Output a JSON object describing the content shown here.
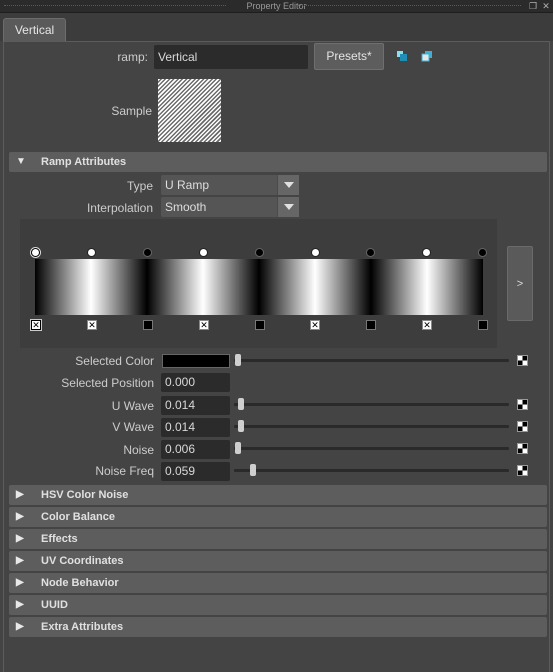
{
  "window": {
    "title": "Property Editor"
  },
  "tabs": [
    {
      "label": "Vertical"
    }
  ],
  "header": {
    "ramp_label": "ramp:",
    "ramp_name": "Vertical",
    "presets_label": "Presets*",
    "sample_label": "Sample"
  },
  "ramp_attributes": {
    "title": "Ramp Attributes",
    "type_label": "Type",
    "type_value": "U Ramp",
    "interpolation_label": "Interpolation",
    "interpolation_value": "Smooth",
    "expand_label": ">"
  },
  "props": {
    "selected_color_label": "Selected Color",
    "selected_color_value": "#000000",
    "selected_position_label": "Selected Position",
    "selected_position_value": "0.000",
    "u_wave_label": "U Wave",
    "u_wave_value": "0.014",
    "v_wave_label": "V Wave",
    "v_wave_value": "0.014",
    "noise_label": "Noise",
    "noise_value": "0.006",
    "noise_freq_label": "Noise Freq",
    "noise_freq_value": "0.059"
  },
  "sections": [
    {
      "label": "HSV Color Noise"
    },
    {
      "label": "Color Balance"
    },
    {
      "label": "Effects"
    },
    {
      "label": "UV Coordinates"
    },
    {
      "label": "Node Behavior"
    },
    {
      "label": "UUID"
    },
    {
      "label": "Extra Attributes"
    }
  ],
  "colors": {
    "background": "#444444",
    "section_header": "#5d5d5d",
    "field": "#2b2b2b",
    "accent": "#3fb0d0"
  }
}
